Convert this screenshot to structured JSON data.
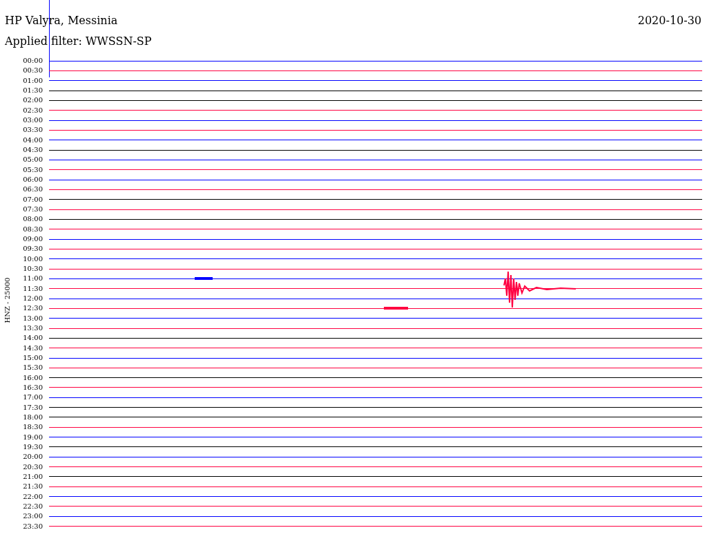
{
  "header": {
    "station": "HP Valyra, Messinia",
    "date": "2020-10-30",
    "filter": "Applied filter: WWSSN-SP"
  },
  "axis_label": "HNZ - 25000",
  "traces": [
    {
      "time": "00:00",
      "color": "#0000ff"
    },
    {
      "time": "00:30",
      "color": "#ff0040"
    },
    {
      "time": "01:00",
      "color": "#0000ff"
    },
    {
      "time": "01:30",
      "color": "#000000"
    },
    {
      "time": "02:00",
      "color": "#000000"
    },
    {
      "time": "02:30",
      "color": "#ff0040"
    },
    {
      "time": "03:00",
      "color": "#0000ff"
    },
    {
      "time": "03:30",
      "color": "#ff0040"
    },
    {
      "time": "04:00",
      "color": "#0000ff"
    },
    {
      "time": "04:30",
      "color": "#000000"
    },
    {
      "time": "05:00",
      "color": "#0000ff"
    },
    {
      "time": "05:30",
      "color": "#ff0040"
    },
    {
      "time": "06:00",
      "color": "#0000ff"
    },
    {
      "time": "06:30",
      "color": "#ff0040"
    },
    {
      "time": "07:00",
      "color": "#000000"
    },
    {
      "time": "07:30",
      "color": "#ff0040"
    },
    {
      "time": "08:00",
      "color": "#000000"
    },
    {
      "time": "08:30",
      "color": "#ff0040"
    },
    {
      "time": "09:00",
      "color": "#0000ff"
    },
    {
      "time": "09:30",
      "color": "#ff0040"
    },
    {
      "time": "10:00",
      "color": "#0000ff"
    },
    {
      "time": "10:30",
      "color": "#ff0040"
    },
    {
      "time": "11:00",
      "color": "#0000ff"
    },
    {
      "time": "11:30",
      "color": "#ff0040"
    },
    {
      "time": "12:00",
      "color": "#0000ff"
    },
    {
      "time": "12:30",
      "color": "#ff0040"
    },
    {
      "time": "13:00",
      "color": "#0000ff"
    },
    {
      "time": "13:30",
      "color": "#ff0040"
    },
    {
      "time": "14:00",
      "color": "#000000"
    },
    {
      "time": "14:30",
      "color": "#ff0040"
    },
    {
      "time": "15:00",
      "color": "#0000ff"
    },
    {
      "time": "15:30",
      "color": "#ff0040"
    },
    {
      "time": "16:00",
      "color": "#000000"
    },
    {
      "time": "16:30",
      "color": "#ff0040"
    },
    {
      "time": "17:00",
      "color": "#0000ff"
    },
    {
      "time": "17:30",
      "color": "#000000"
    },
    {
      "time": "18:00",
      "color": "#000000"
    },
    {
      "time": "18:30",
      "color": "#ff0040"
    },
    {
      "time": "19:00",
      "color": "#0000ff"
    },
    {
      "time": "19:30",
      "color": "#000000"
    },
    {
      "time": "20:00",
      "color": "#0000ff"
    },
    {
      "time": "20:30",
      "color": "#ff0040"
    },
    {
      "time": "21:00",
      "color": "#000000"
    },
    {
      "time": "21:30",
      "color": "#ff0040"
    },
    {
      "time": "22:00",
      "color": "#0000ff"
    },
    {
      "time": "22:30",
      "color": "#ff0040"
    },
    {
      "time": "23:00",
      "color": "#0000ff"
    },
    {
      "time": "23:30",
      "color": "#ff0040"
    }
  ]
}
